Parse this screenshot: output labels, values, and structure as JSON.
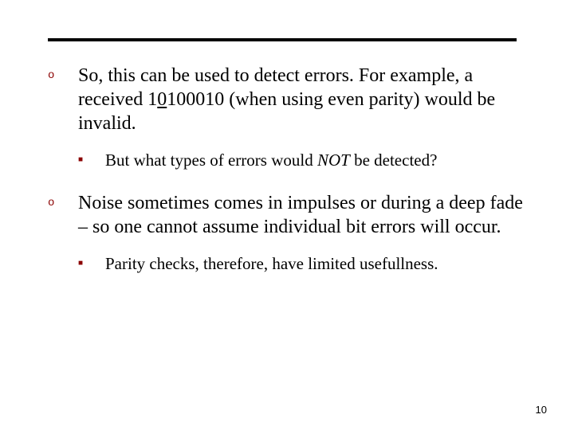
{
  "items": [
    {
      "text_pre": "So, this can be used to detect errors. For example, a received 1",
      "text_ul": "0",
      "text_post": "100010 (when using even parity) would be invalid.",
      "sub": {
        "pre": "But what types of errors would ",
        "em": "NOT",
        "post": " be detected?"
      }
    },
    {
      "text": "Noise sometimes comes in impulses or during a deep fade – so one cannot assume individual bit errors will occur.",
      "sub": {
        "text": "Parity checks, therefore, have limited usefullness."
      }
    }
  ],
  "page_number": "10",
  "bullets": {
    "open_square": "o",
    "filled_square": "■"
  }
}
